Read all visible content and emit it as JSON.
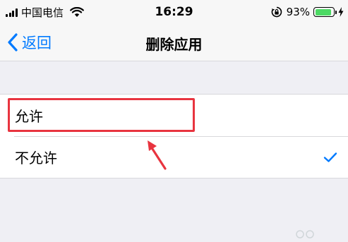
{
  "status_bar": {
    "carrier": "中国电信",
    "time": "16:29",
    "battery_percent": "93%",
    "battery_level": 0.93,
    "battery_color": "#4cd964"
  },
  "nav": {
    "back_label": "返回",
    "title": "删除应用",
    "accent_color": "#007aff"
  },
  "options": [
    {
      "label": "允许",
      "selected": false
    },
    {
      "label": "不允许",
      "selected": true
    }
  ],
  "annotation": {
    "highlight_color": "#e8343f",
    "highlighted_option": "允许"
  },
  "icons": {
    "signal": "signal-bars-icon",
    "wifi": "wifi-icon",
    "rotation_lock": "rotation-lock-icon",
    "battery": "battery-icon",
    "charging": "charging-bolt-icon",
    "back": "chevron-left-icon",
    "check": "checkmark-icon"
  }
}
